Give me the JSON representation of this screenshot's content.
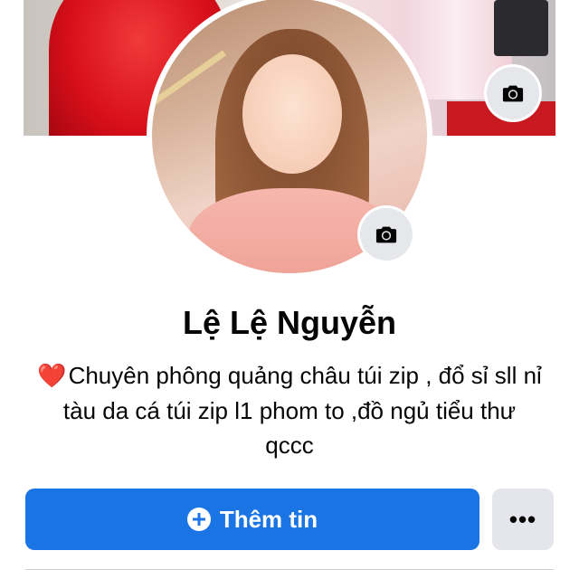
{
  "profile": {
    "name": "Lệ Lệ Nguyễn",
    "bio_text": "Chuyên phông quảng châu túi zip , đổ sỉ sll nỉ tàu  da cá túi zip l1 phom to ,đồ ngủ tiểu thư qccc",
    "bio_emoji": "❤️"
  },
  "actions": {
    "add_info_label": "Thêm tin",
    "more_label": "•••"
  },
  "icons": {
    "cover_camera": "camera-icon",
    "avatar_camera": "camera-icon",
    "add": "plus-circle-icon",
    "more": "ellipsis-icon"
  },
  "colors": {
    "primary": "#1b74e4",
    "secondary_button": "#e4e6eb",
    "text": "#050505"
  }
}
